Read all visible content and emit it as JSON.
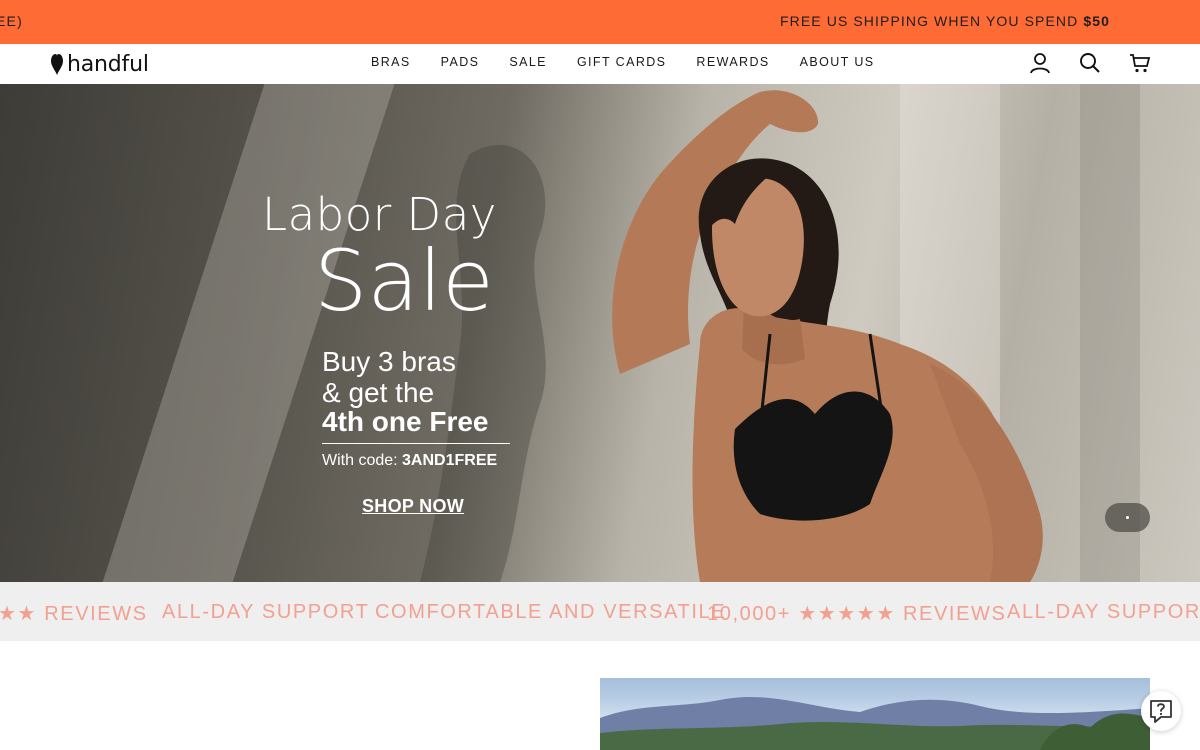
{
  "announcement": {
    "left_text": "EE)",
    "right_prefix": "FREE US SHIPPING WHEN YOU SPEND ",
    "right_amount": "$50"
  },
  "header": {
    "logo_text": "handful",
    "nav": [
      "BRAS",
      "PADS",
      "SALE",
      "GIFT CARDS",
      "REWARDS",
      "ABOUT US"
    ],
    "icons": [
      "account-icon",
      "search-icon",
      "cart-icon"
    ]
  },
  "hero": {
    "line1": "Labor Day",
    "line2": "Sale",
    "line3": "Buy 3 bras",
    "line4": "& get the",
    "line5": "4th one Free",
    "code_prefix": "With code: ",
    "code": "3AND1FREE",
    "cta": "SHOP NOW"
  },
  "marquee": {
    "items": [
      "★★ REVIEWS",
      "ALL-DAY SUPPORT",
      "COMFORTABLE AND VERSATILE",
      "10,000+ ★★★★★ REVIEWS",
      "ALL-DAY SUPPORT"
    ]
  },
  "colors": {
    "announcement_bg": "#ff6b35",
    "marquee_text": "#f2a08f",
    "marquee_bg": "#efefef"
  }
}
